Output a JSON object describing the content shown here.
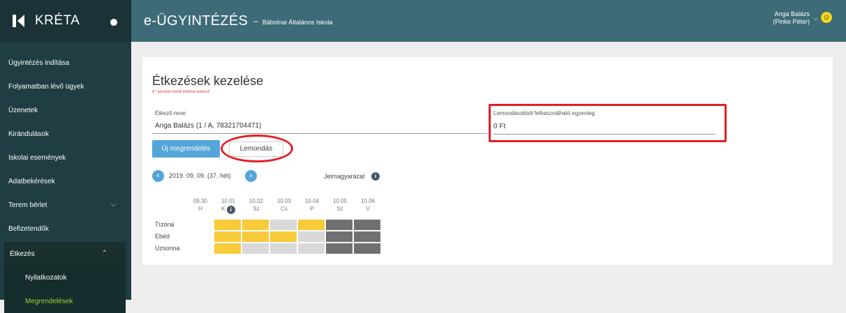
{
  "brand": {
    "name": "KRÉTA"
  },
  "sidebar": {
    "items": [
      {
        "label": "Ügyintézés indítása"
      },
      {
        "label": "Folyamatban lévő ügyek"
      },
      {
        "label": "Üzenetek"
      },
      {
        "label": "Kirándulások"
      },
      {
        "label": "Iskolai események"
      },
      {
        "label": "Adatbekérések"
      },
      {
        "label": "Terem bérlet"
      },
      {
        "label": "Befizetendők"
      },
      {
        "label": "Étkezés"
      }
    ],
    "sub_items": [
      {
        "label": "Nyilatkozatok"
      },
      {
        "label": "Megrendelések"
      }
    ]
  },
  "header": {
    "title": "e-ÜGYINTÉZÉS",
    "dash": "–",
    "school": "Bábolnai Általános Iskola",
    "user_name": "Anga Balázs",
    "user_sub": "(Pinke Péter)"
  },
  "page": {
    "title": "Étkezések kezelése",
    "required_note": "A *-gal jelölt mezők kitöltése kötelező",
    "eater_label": "Étkező neve",
    "eater_value": "Anga Balázs (1 / A, 78321704471)",
    "balance_label": "Lemondásokból felhasználható egyenleg",
    "balance_value": "0 Ft",
    "new_order_label": "Új megrendelés",
    "cancel_label": "Lemondás",
    "week_label": "2019. 09. 09. (37. hét)",
    "legend_label": "Jelmagyarázat"
  },
  "schedule": {
    "days": [
      {
        "date": "09.30",
        "day": "H"
      },
      {
        "date": "10.01",
        "day": "K"
      },
      {
        "date": "10.02",
        "day": "Sz"
      },
      {
        "date": "10.03",
        "day": "Cs"
      },
      {
        "date": "10.04",
        "day": "P"
      },
      {
        "date": "10.05",
        "day": "Sz"
      },
      {
        "date": "10.06",
        "day": "V"
      }
    ],
    "meals": [
      {
        "label": "Tízórai"
      },
      {
        "label": "Ebéd"
      },
      {
        "label": "Uzsonna"
      }
    ],
    "status_colors": {
      "ordered": "#f7cb3a",
      "none": "#d9d9d9",
      "closed": "#707070"
    },
    "grid": [
      [
        "",
        "ordered",
        "ordered",
        "none",
        "ordered",
        "closed",
        "closed"
      ],
      [
        "",
        "ordered",
        "ordered",
        "ordered",
        "none",
        "closed",
        "closed"
      ],
      [
        "",
        "ordered",
        "none",
        "none",
        "none",
        "closed",
        "closed"
      ]
    ]
  }
}
